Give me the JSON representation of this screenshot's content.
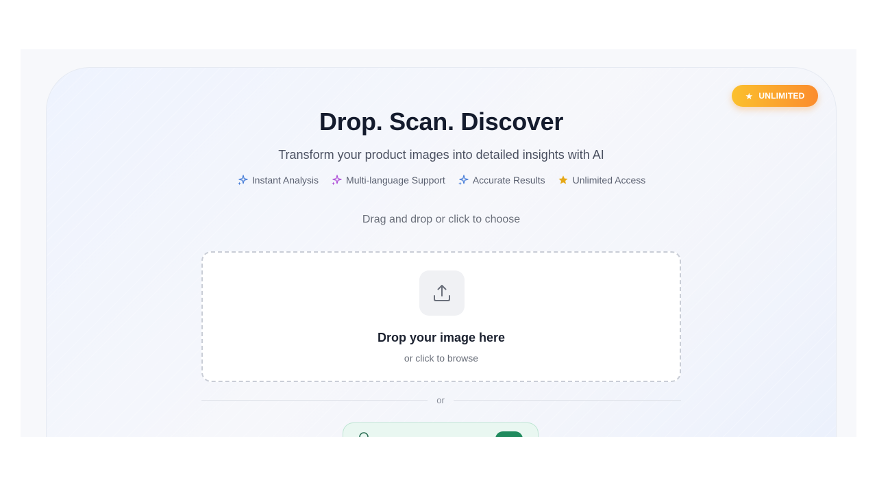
{
  "badge": {
    "label": "UNLIMITED",
    "star": "★",
    "colors": {
      "start": "#fbc02d",
      "end": "#fb8c2d"
    }
  },
  "hero": {
    "title": "Drop. Scan. Discover",
    "subtitle": "Transform your product images into detailed insights with AI"
  },
  "features": [
    {
      "label": "Instant Analysis",
      "icon": "sparkle-icon",
      "color": "#4a7fd8"
    },
    {
      "label": "Multi-language Support",
      "icon": "sparkle-icon",
      "color": "#b050d8"
    },
    {
      "label": "Accurate Results",
      "icon": "sparkle-icon",
      "color": "#4a7fd8"
    },
    {
      "label": "Unlimited Access",
      "icon": "star-icon",
      "color": "#e6a817"
    }
  ],
  "upload": {
    "hint": "Drag and drop or click to choose",
    "title": "Drop your image here",
    "subtitle": "or click to browse",
    "icon": "upload-icon"
  },
  "divider": {
    "label": "or"
  },
  "camera": {
    "label": "",
    "icon": "camera-icon",
    "accent": "#1f8a5d"
  }
}
